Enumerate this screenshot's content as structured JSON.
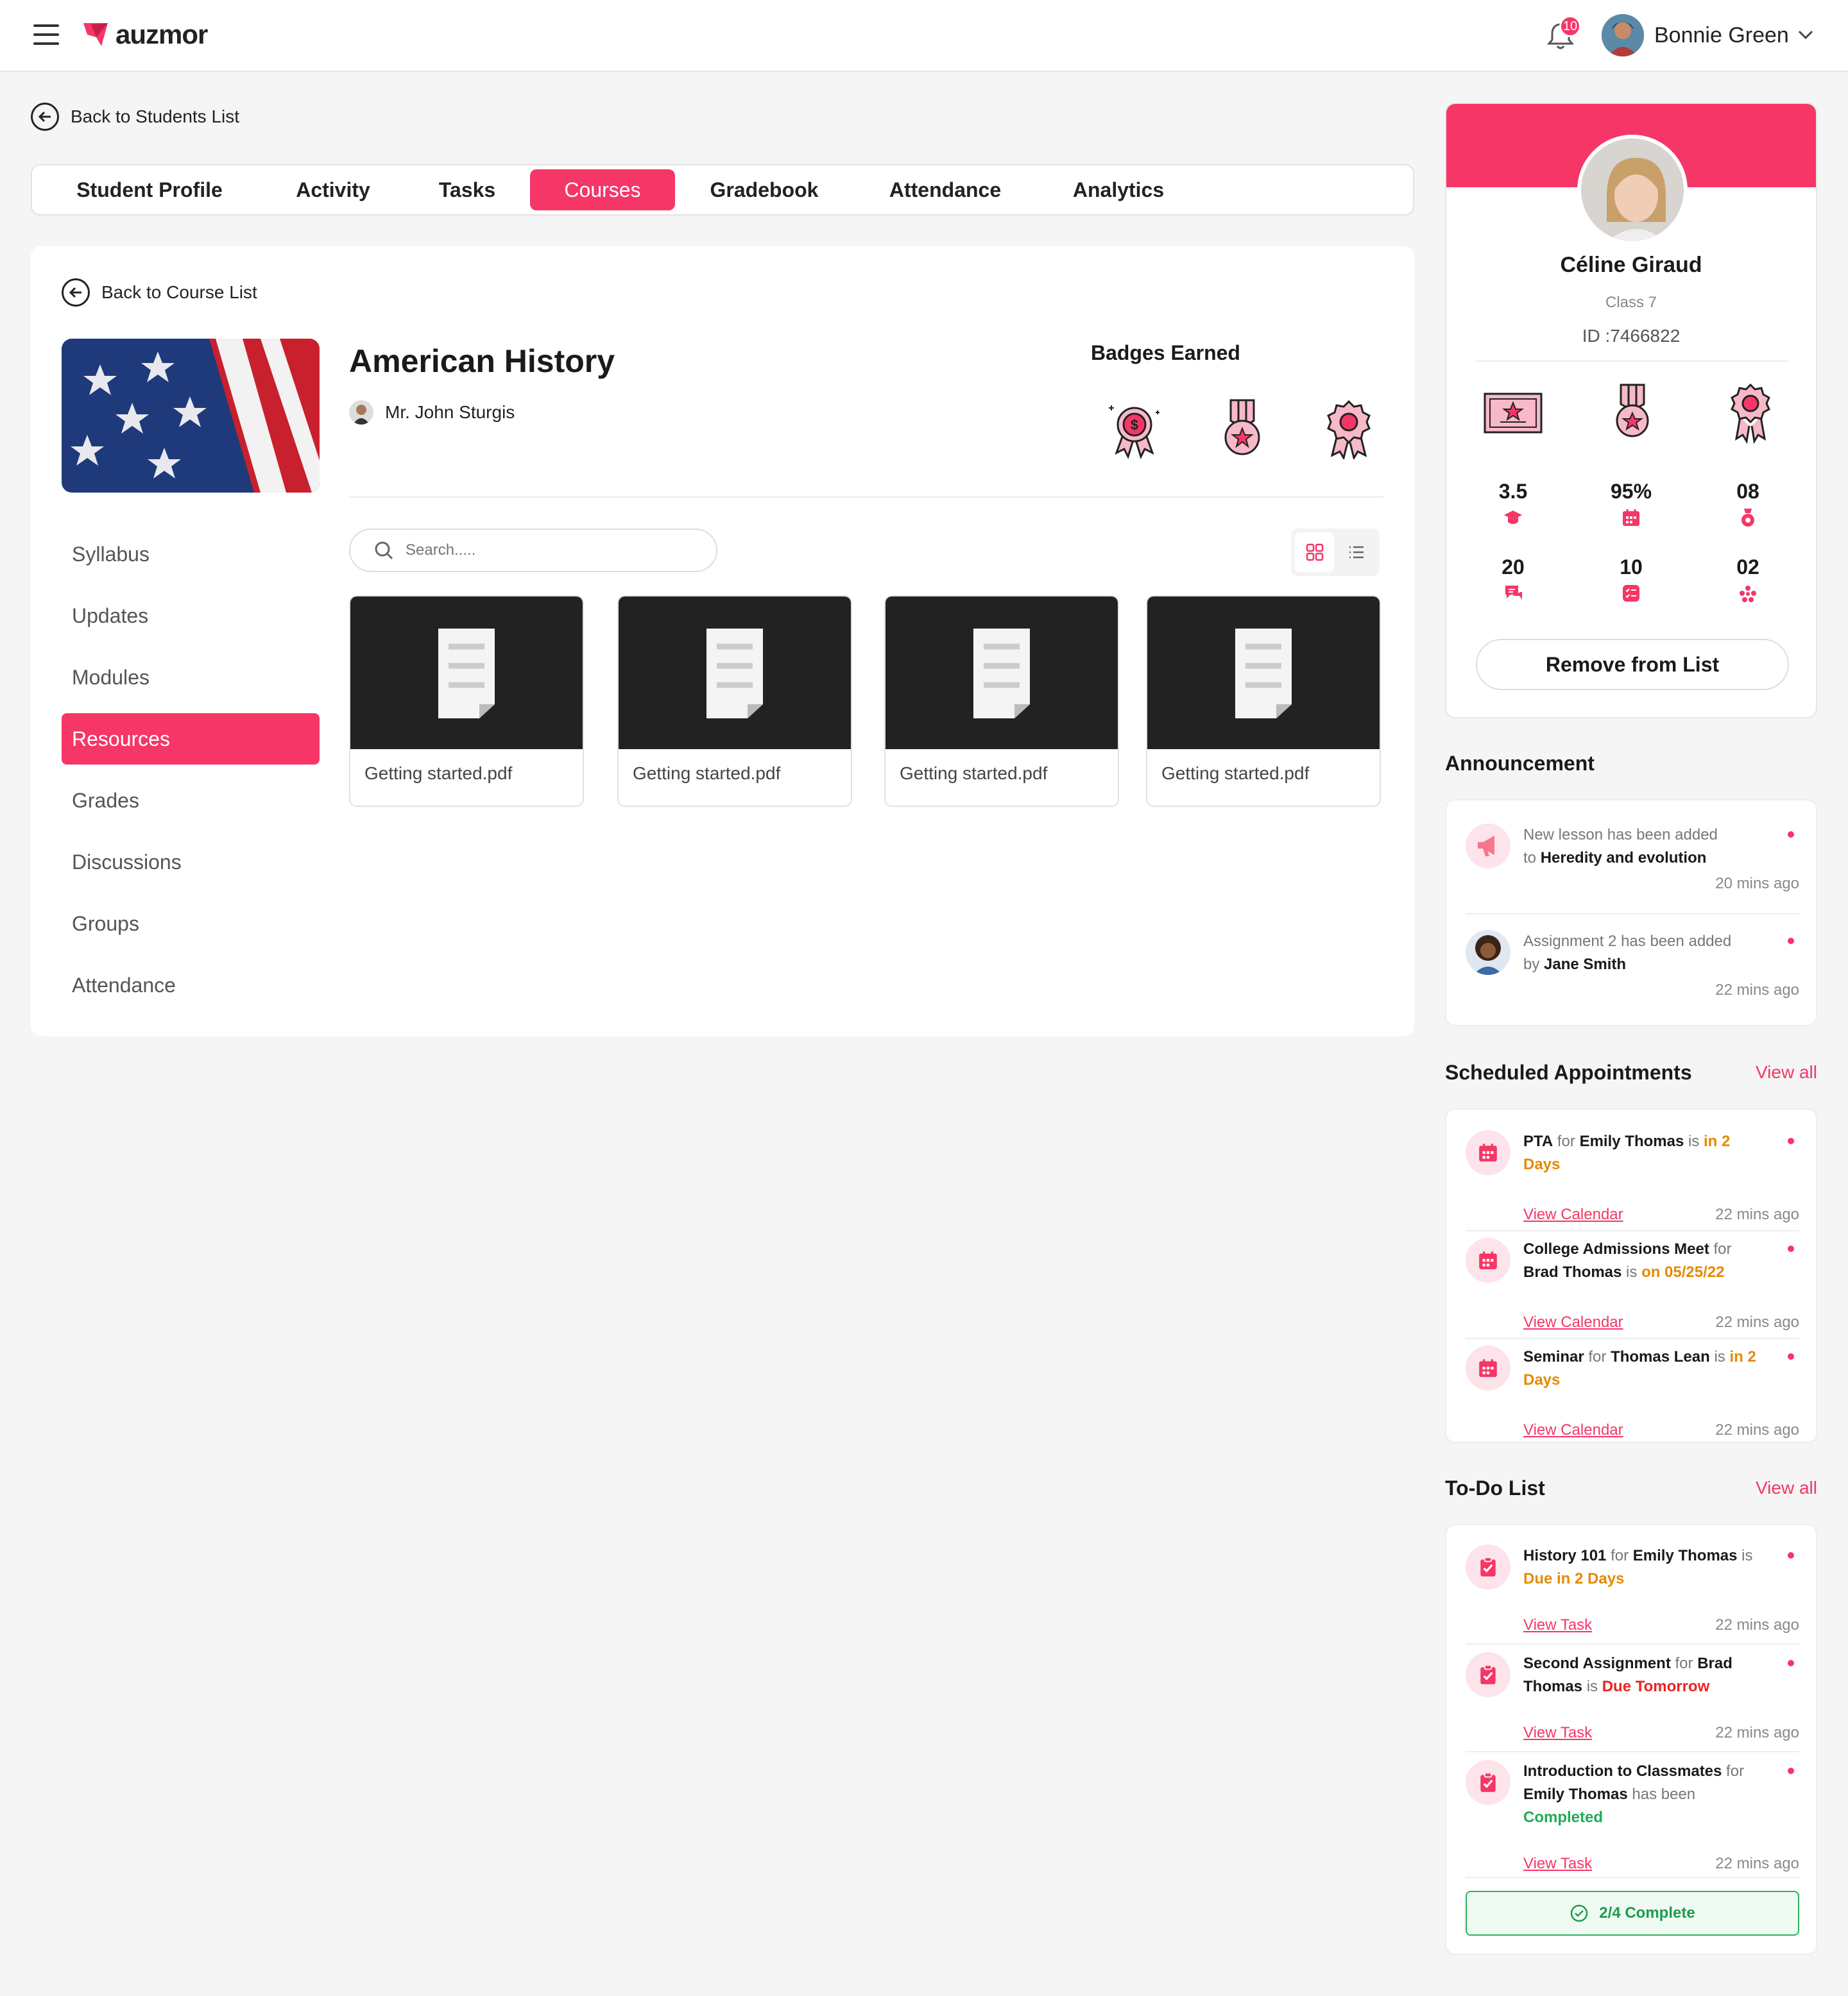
{
  "header": {
    "brand": "auzmor",
    "notification_count": "10",
    "user_name": "Bonnie Green"
  },
  "back_students": "Back to Students List",
  "tabs": [
    {
      "label": "Student Profile"
    },
    {
      "label": "Activity"
    },
    {
      "label": "Tasks"
    },
    {
      "label": "Courses",
      "active": true
    },
    {
      "label": "Gradebook"
    },
    {
      "label": "Attendance"
    },
    {
      "label": "Analytics"
    }
  ],
  "course": {
    "back_label": "Back to Course List",
    "title": "American History",
    "teacher": "Mr. John Sturgis",
    "badges_title": "Badges Earned",
    "badges": [
      "dollar-badge-icon",
      "medal-icon",
      "rosette-icon"
    ]
  },
  "side_menu": [
    {
      "label": "Syllabus"
    },
    {
      "label": "Updates"
    },
    {
      "label": "Modules"
    },
    {
      "label": "Resources",
      "active": true
    },
    {
      "label": "Grades"
    },
    {
      "label": "Discussions"
    },
    {
      "label": "Groups"
    },
    {
      "label": "Attendance"
    }
  ],
  "search": {
    "placeholder": "Search....."
  },
  "files": [
    {
      "name": "Getting started.pdf"
    },
    {
      "name": "Getting started.pdf"
    },
    {
      "name": "Getting started.pdf"
    },
    {
      "name": "Getting started.pdf"
    }
  ],
  "profile": {
    "name": "Céline Giraud",
    "class": "Class 7",
    "id": "ID :7466822",
    "stats": [
      {
        "value": "3.5",
        "icon": "graduation-cap-icon"
      },
      {
        "value": "95%",
        "icon": "calendar-icon"
      },
      {
        "value": "08",
        "icon": "medal-icon"
      },
      {
        "value": "20",
        "icon": "chat-icon"
      },
      {
        "value": "10",
        "icon": "checklist-icon"
      },
      {
        "value": "02",
        "icon": "group-icon"
      }
    ],
    "remove_label": "Remove from List"
  },
  "announcement": {
    "title": "Announcement",
    "items": [
      {
        "text": "New lesson has been added",
        "prefix": "to",
        "bold": "Heredity and evolution",
        "time": "20 mins ago"
      },
      {
        "text": "Assignment 2 has been added",
        "prefix": "by",
        "bold": "Jane Smith",
        "time": "22 mins ago"
      }
    ]
  },
  "appointments": {
    "title": "Scheduled Appointments",
    "view_all": "View all",
    "items": [
      {
        "event": "PTA",
        "for": "for",
        "person": "Emily Thomas",
        "is": "is",
        "when": "in 2 Days",
        "link": "View Calendar",
        "time": "22 mins ago"
      },
      {
        "event": "College Admissions Meet",
        "for": "for",
        "person": "Brad Thomas",
        "is": "is",
        "when": "on 05/25/22",
        "link": "View Calendar",
        "time": "22 mins ago"
      },
      {
        "event": "Seminar",
        "for": "for",
        "person": "Thomas Lean",
        "is": "is",
        "when": "in 2 Days",
        "link": "View Calendar",
        "time": "22 mins ago"
      }
    ]
  },
  "todo": {
    "title": "To-Do List",
    "view_all": "View all",
    "items": [
      {
        "task": "History 101",
        "for": "for",
        "person": "Emily Thomas",
        "is": "is",
        "status": "Due in 2 Days",
        "link": "View Task",
        "time": "22 mins ago"
      },
      {
        "task": "Second Assignment",
        "for": "for",
        "person": "Brad Thomas",
        "is": "is",
        "status": "Due Tomorrow",
        "link": "View Task",
        "time": "22 mins ago"
      },
      {
        "task": "Introduction to Classmates",
        "for": "for",
        "person": "Emily Thomas",
        "is": "has been",
        "status": "Completed",
        "link": "View Task",
        "time": "22 mins ago"
      }
    ],
    "complete_label": "2/4 Complete"
  },
  "colors": {
    "accent": "#f53667",
    "orange": "#e58a00",
    "red": "#ee2222",
    "green": "#22aa55"
  }
}
